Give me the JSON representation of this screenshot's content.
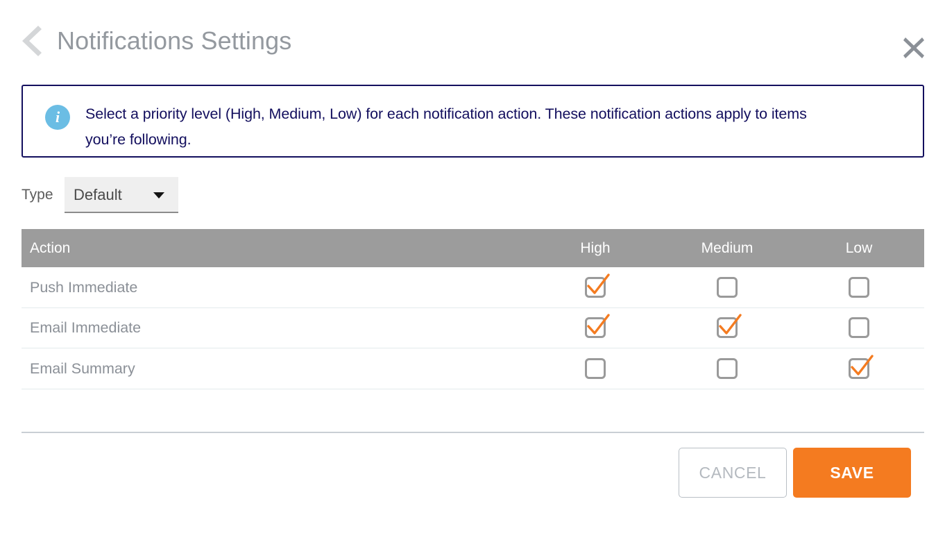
{
  "header": {
    "back_icon": "chevron-left-icon",
    "title": "Notifications Settings",
    "close_icon": "close-icon"
  },
  "banner": {
    "icon": "info-icon",
    "text": "Select a priority level (High, Medium, Low) for each notification action. These notification actions apply to items you’re following.",
    "border_color": "#130f5e",
    "icon_color": "#6bbde4",
    "text_color": "#130f5e"
  },
  "type_filter": {
    "label": "Type",
    "value": "Default",
    "options": [
      "Default"
    ],
    "caret_icon": "chevron-down-icon"
  },
  "table": {
    "header_bg": "#9c9c9c",
    "columns": [
      "Action",
      "High",
      "Medium",
      "Low"
    ],
    "rows": [
      {
        "action": "Push Immediate",
        "high": true,
        "medium": false,
        "low": false
      },
      {
        "action": "Email Immediate",
        "high": true,
        "medium": true,
        "low": false
      },
      {
        "action": "Email Summary",
        "high": false,
        "medium": false,
        "low": true
      }
    ],
    "checked_color": "#f47b20",
    "box_color": "#9a9a9a"
  },
  "footer": {
    "cancel_label": "CANCEL",
    "save_label": "SAVE",
    "save_bg": "#f47b20"
  }
}
